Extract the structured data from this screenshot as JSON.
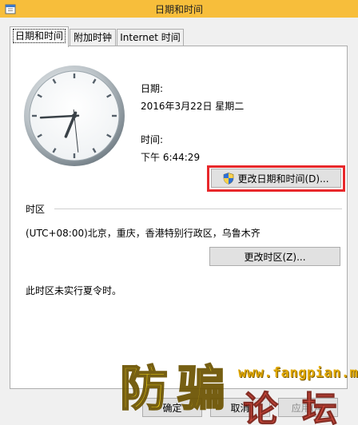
{
  "window": {
    "title": "日期和时间"
  },
  "tabs": [
    {
      "label": "日期和时间"
    },
    {
      "label": "附加时钟"
    },
    {
      "label": "Internet 时间"
    }
  ],
  "clock": {
    "hour": 6,
    "minute": 44,
    "second": 29
  },
  "date": {
    "label": "日期:",
    "value": "2016年3月22日 星期二"
  },
  "time": {
    "label": "时间:",
    "value": "下午 6:44:29"
  },
  "change_datetime_button": {
    "label": "更改日期和时间(D)..."
  },
  "timezone": {
    "section_label": "时区",
    "value": "(UTC+08:00)北京，重庆，香港特别行政区，乌鲁木齐",
    "change_button": "更改时区(Z)...",
    "dst_note": "此时区未实行夏令时。"
  },
  "footer": {
    "ok": "确定",
    "cancel": "取消",
    "apply": "应用(A)"
  },
  "watermark": {
    "url": "www.fangpian.me",
    "char1": "防",
    "char2": "骗",
    "char3": "论",
    "char4": "坛"
  },
  "colors": {
    "titlebar": "#f7be3b",
    "highlight": "#e8282b",
    "watermark_yellow": "#f3d400",
    "watermark_red": "#d93a2b"
  }
}
